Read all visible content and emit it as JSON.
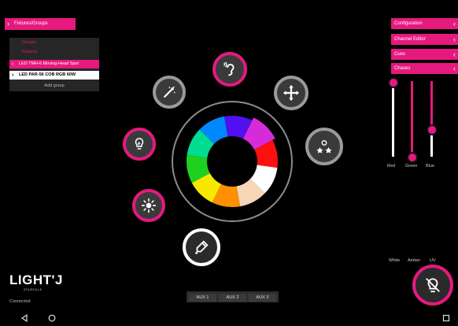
{
  "app": {
    "logo": "LIGHT'J",
    "brand": "STAIRVILLE",
    "status": "Connected"
  },
  "left": {
    "tab_label": "Fixtures/Groups",
    "rows": [
      {
        "label": "Groups"
      },
      {
        "label": "Fixtures"
      },
      {
        "label": "LED TMH-6 Moving-Head Spot"
      },
      {
        "label": "LED PAR-56 COB RGB 60W"
      },
      {
        "label": "Add group"
      }
    ]
  },
  "right": {
    "tabs": [
      {
        "label": "Configuration"
      },
      {
        "label": "Channel Editor"
      },
      {
        "label": "Cues"
      },
      {
        "label": "Chases"
      }
    ],
    "sliders": [
      {
        "label": "Red",
        "value": 0.95
      },
      {
        "label": "Green",
        "value": 0.0
      },
      {
        "label": "Blue",
        "value": 0.45
      }
    ],
    "extra_labels": [
      "White",
      "Amber",
      "UV"
    ]
  },
  "aux": [
    "AUX 1",
    "AUX 2",
    "AUX 3"
  ],
  "wheel_colors": [
    "#5010f0",
    "#d52bd8",
    "#ff1010",
    "#ffffff",
    "#f7d6b8",
    "#ff9000",
    "#f8e800",
    "#20d020",
    "#00dd90",
    "#0088ff"
  ],
  "icons": {
    "hearing": "ear-icon",
    "move": "move-icon",
    "effects": "fx-icon",
    "strobe": "strobe-icon",
    "gobo": "lamp-icon",
    "dimmer": "brightness-icon",
    "color": "color-picker-icon",
    "blackout": "blackout-icon"
  },
  "colors": {
    "accent": "#e6197f",
    "background": "#000000",
    "panel": "#262626"
  }
}
